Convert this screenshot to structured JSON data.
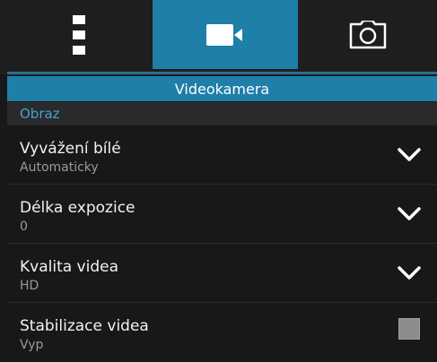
{
  "tabs": [
    {
      "icon": "menu-vertical-icon",
      "selected": false
    },
    {
      "icon": "video-camera-icon",
      "selected": true
    },
    {
      "icon": "camera-icon",
      "selected": false
    }
  ],
  "header": {
    "title": "Videokamera"
  },
  "section": {
    "title": "Obraz"
  },
  "settings": [
    {
      "title": "Vyvážení bílé",
      "value": "Automaticky",
      "control": "dropdown"
    },
    {
      "title": "Délka expozice",
      "value": "0",
      "control": "dropdown"
    },
    {
      "title": "Kvalita videa",
      "value": "HD",
      "control": "dropdown"
    },
    {
      "title": "Stabilizace videa",
      "value": "Vyp",
      "control": "checkbox",
      "checked": false
    }
  ],
  "colors": {
    "accent": "#1e7fa8",
    "section_text": "#3fa6d6",
    "background": "#181818"
  }
}
